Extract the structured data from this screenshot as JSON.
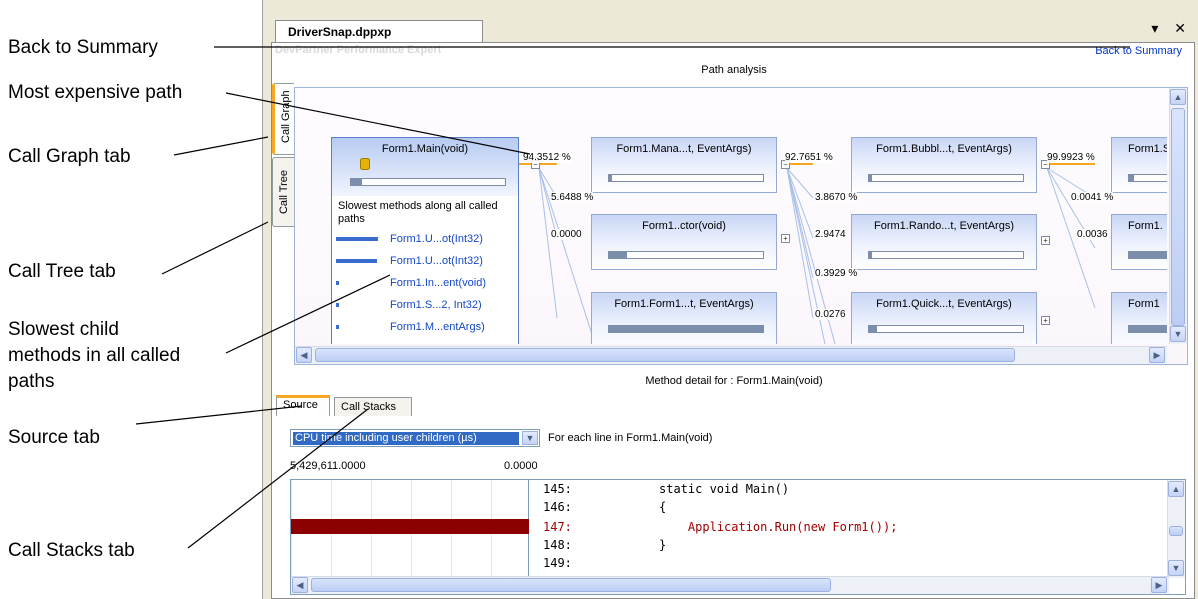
{
  "callouts": {
    "back_to_summary": "Back to Summary",
    "most_expensive_path": "Most expensive path",
    "call_graph_tab": "Call Graph tab",
    "call_tree_tab": "Call Tree tab",
    "slowest_line1": "Slowest child",
    "slowest_line2": "methods in all called",
    "slowest_line3": "paths",
    "source_tab": "Source tab",
    "call_stacks_tab": "Call Stacks tab"
  },
  "window": {
    "doc_tab": "DriverSnap.dppxp",
    "controls": "▾ ✕",
    "watermark": "DevPartner Performance Expert",
    "back_link": "Back to Summary",
    "path_title": "Path analysis",
    "detail_title": "Method detail for : Form1.Main(void)"
  },
  "side_tabs": {
    "call_graph": "Call Graph",
    "call_tree": "Call Tree"
  },
  "graph": {
    "main_node": {
      "label": "Form1.Main(void)",
      "slowest_title": "Slowest methods along all called paths",
      "slowest": [
        {
          "label": "Form1.U...ot(Int32)",
          "fraction": 1.0
        },
        {
          "label": "Form1.U...ot(Int32)",
          "fraction": 0.98
        },
        {
          "label": "Form1.In...ent(void)",
          "fraction": 0.06
        },
        {
          "label": "Form1.S...2, Int32)",
          "fraction": 0.04
        },
        {
          "label": "Form1.M...entArgs)",
          "fraction": 0.03
        }
      ],
      "fill": 0.07
    },
    "nodes": [
      {
        "label": "Form1.Mana...t, EventArgs)",
        "fill": 0.02
      },
      {
        "label": "Form1..ctor(void)",
        "fill": 0.12
      },
      {
        "label": "Form1.Form1...t, EventArgs)",
        "fill": 1.0
      },
      {
        "label": "Form1.Bubbl...t, EventArgs)",
        "fill": 0.02
      },
      {
        "label": "Form1.Rando...t, EventArgs)",
        "fill": 0.02
      },
      {
        "label": "Form1.Quick...t, EventArgs)",
        "fill": 0.05
      },
      {
        "label": "Form1.S",
        "fill": 0.1
      },
      {
        "label": "Form1.",
        "fill": 1.0
      },
      {
        "label": "Form1",
        "fill": 1.0
      }
    ],
    "percents": {
      "p1": "94.3512 %",
      "p2": "5.6488 %",
      "p3": "0.0000",
      "p4": "92.7651 %",
      "p5": "3.8670 %",
      "p6": "2.9474",
      "p7": "0.3929 %",
      "p8": "0.0276",
      "p9": "99.9923 %",
      "p10": "0.0041 %",
      "p11": "0.0036"
    }
  },
  "detail": {
    "tabs": {
      "source": "Source",
      "call_stacks": "Call Stacks"
    },
    "metric": "CPU time including user children (µs)",
    "for_each": "For each line in Form1.Main(void)",
    "scale_max": "5,429,611.0000",
    "scale_min": "0.0000",
    "code": [
      {
        "ln": "145:",
        "text": "static void Main()",
        "hot": false
      },
      {
        "ln": "146:",
        "text": "{",
        "hot": false
      },
      {
        "ln": "147:",
        "text": "    Application.Run(new Form1());",
        "hot": true
      },
      {
        "ln": "148:",
        "text": "}",
        "hot": false
      },
      {
        "ln": "149:",
        "text": "",
        "hot": false
      }
    ]
  },
  "colors": {
    "hot_path": "#f5a623",
    "hot_line": "#8b0000",
    "link": "#0033cc"
  }
}
